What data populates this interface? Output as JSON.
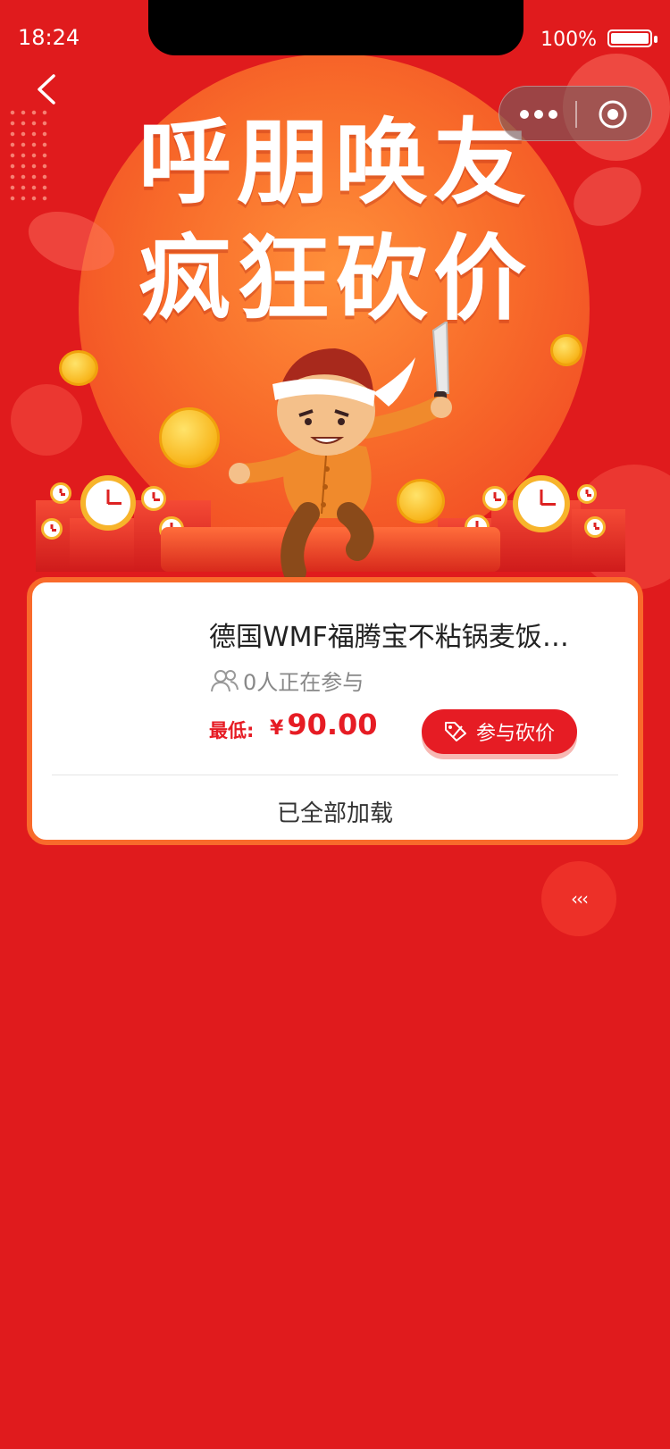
{
  "status_bar": {
    "time": "18:24",
    "battery": "100%"
  },
  "banner": {
    "line1": "呼朋唤友",
    "line2": "疯狂砍价"
  },
  "product": {
    "title": "德国WMF福腾宝不粘锅麦饭石…",
    "participants_count": "0人正在参与",
    "price_label": "最低:",
    "currency": "¥",
    "price": "90.00",
    "action_label": "参与砍价"
  },
  "list_status": "已全部加载",
  "float_button": {
    "label": "‹‹‹"
  },
  "colors": {
    "background": "#e01b1d",
    "accent": "#e61c24",
    "card_border": "#f96a2b"
  }
}
